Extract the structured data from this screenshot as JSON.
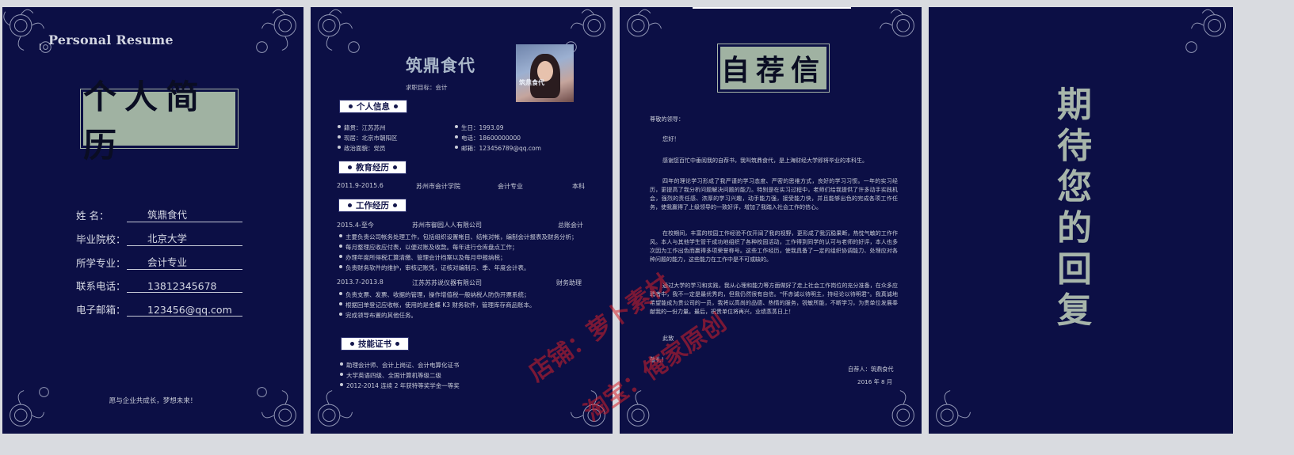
{
  "page1": {
    "title": "Personal Resume",
    "heading": "个人简历",
    "fields": [
      {
        "label": "姓    名：",
        "value": "筑鼎食代"
      },
      {
        "label": "毕业院校：",
        "value": "北京大学"
      },
      {
        "label": "所学专业：",
        "value": "会计专业"
      },
      {
        "label": "联系电话：",
        "value": "13812345678"
      },
      {
        "label": "电子邮箱：",
        "value": "123456@qq.com"
      }
    ],
    "footer": "愿与企业共成长，梦想未来！"
  },
  "page2": {
    "name": "筑鼎食代",
    "target": "求职目标：会计",
    "photo_caption": "筑鼎食代",
    "sections": {
      "info": "个人信息",
      "education": "教育经历",
      "work": "工作经历",
      "skills": "技能证书"
    },
    "info_left": [
      "籍贯：江苏苏州",
      "现居：北京市朝阳区",
      "政治面貌：党员"
    ],
    "info_right": [
      "生日：1993.09",
      "电话：18600000000",
      "邮箱：123456789@qq.com"
    ],
    "education": {
      "period": "2011.9-2015.6",
      "school": "苏州市会计学院",
      "major": "会计专业",
      "degree": "本科"
    },
    "jobs": [
      {
        "period": "2015.4-至今",
        "company": "苏州市御园人人有限公司",
        "role": "总账会计",
        "duties": [
          "主要负责公司帐务处理工作，包括组织设置帐目、结帐对帐，编制会计报表及财务分析；",
          "每月整理应收应付表，以便对账及收款。每年进行仓库盘点工作；",
          "办理年度所得税汇算清缴、管理会计档案以及每月申报纳税；",
          "负责财务软件的维护，审核记账凭，证核对编制月、季、年度会计表。"
        ]
      },
      {
        "period": "2013.7-2013.8",
        "company": "江苏苏苏说仪器有限公司",
        "role": "财务助理",
        "duties": [
          "负责支票、发票、收据的管理，操作增值税一般纳税人防伪开票系统；",
          "根据回单登记应收帐，使用的是金蝶 K3 财务软件，管理库存商品账本。",
          "完成领导布置的其他任务。"
        ]
      }
    ],
    "skills": [
      "助理会计师、会计上岗证、会计电算化证书",
      "大学英语四级、全国计算机等级二级",
      "2012-2014 连续 2 年获特等奖学金一等奖"
    ]
  },
  "page3": {
    "heading": "自荐信",
    "greeting": "尊敬的领导：",
    "hello": "您好！",
    "paragraphs": [
      "感谢您百忙中垂阅我的自荐书，我叫筑鼎食代，是上海财经大学即将毕业的本科生。",
      "四年的理论学习形成了我严谨的学习态度、严密的思维方式，良好的学习习惯。一年的实习经历，更提高了我分析问题解决问题的能力。特别是在实习过程中，老师们给我提供了许多动手实践机会，强烈的责任感、浓厚的学习兴趣，动手能力强，接受能力快，并且能够出色的完成各项工作任务，使我赢得了上级领导的一致好评，增加了我踏入社会工作的信心。",
      "在校期间，丰富的校园工作经验不仅开阔了我的视野，更形成了我沉稳果断，热忱气敏的工作作风。本人与其他学生管干成功地组织了各种校园活动，工作得到同学的认可与老师的好评，本人也多次因为工作出色而赢得多项荣誉称号。这些工作经历，使我具备了一定的组织协调能力、处理应对各种问题的能力，这些能力在工作中是不可或缺的。",
      "通过大学的学习和实践，我从心理和能力等方面做好了走上社会工作岗位的充分准备，在众多应聘者中，我不一定是最优秀的，但我仍然很有自信。\"怀赤诚以待明主，持经论以待明君\"。我真诚地希望能成为贵公司的一员，我将以高尚的品德、热情的服务，锐敏所能，不断学习，为贵单位发展奉献我的一份力量。最后，祝贵单位将再兴，业绩蒸蒸日上！"
    ],
    "closing": "此致",
    "salute": "敬礼！",
    "signature": "自荐人：筑鼎食代",
    "date": "2016 年 8 月"
  },
  "page4": {
    "closing_text": "期待您的回复"
  },
  "watermark": [
    "店铺：萝卜素材",
    "淘宝：俺家原创"
  ]
}
